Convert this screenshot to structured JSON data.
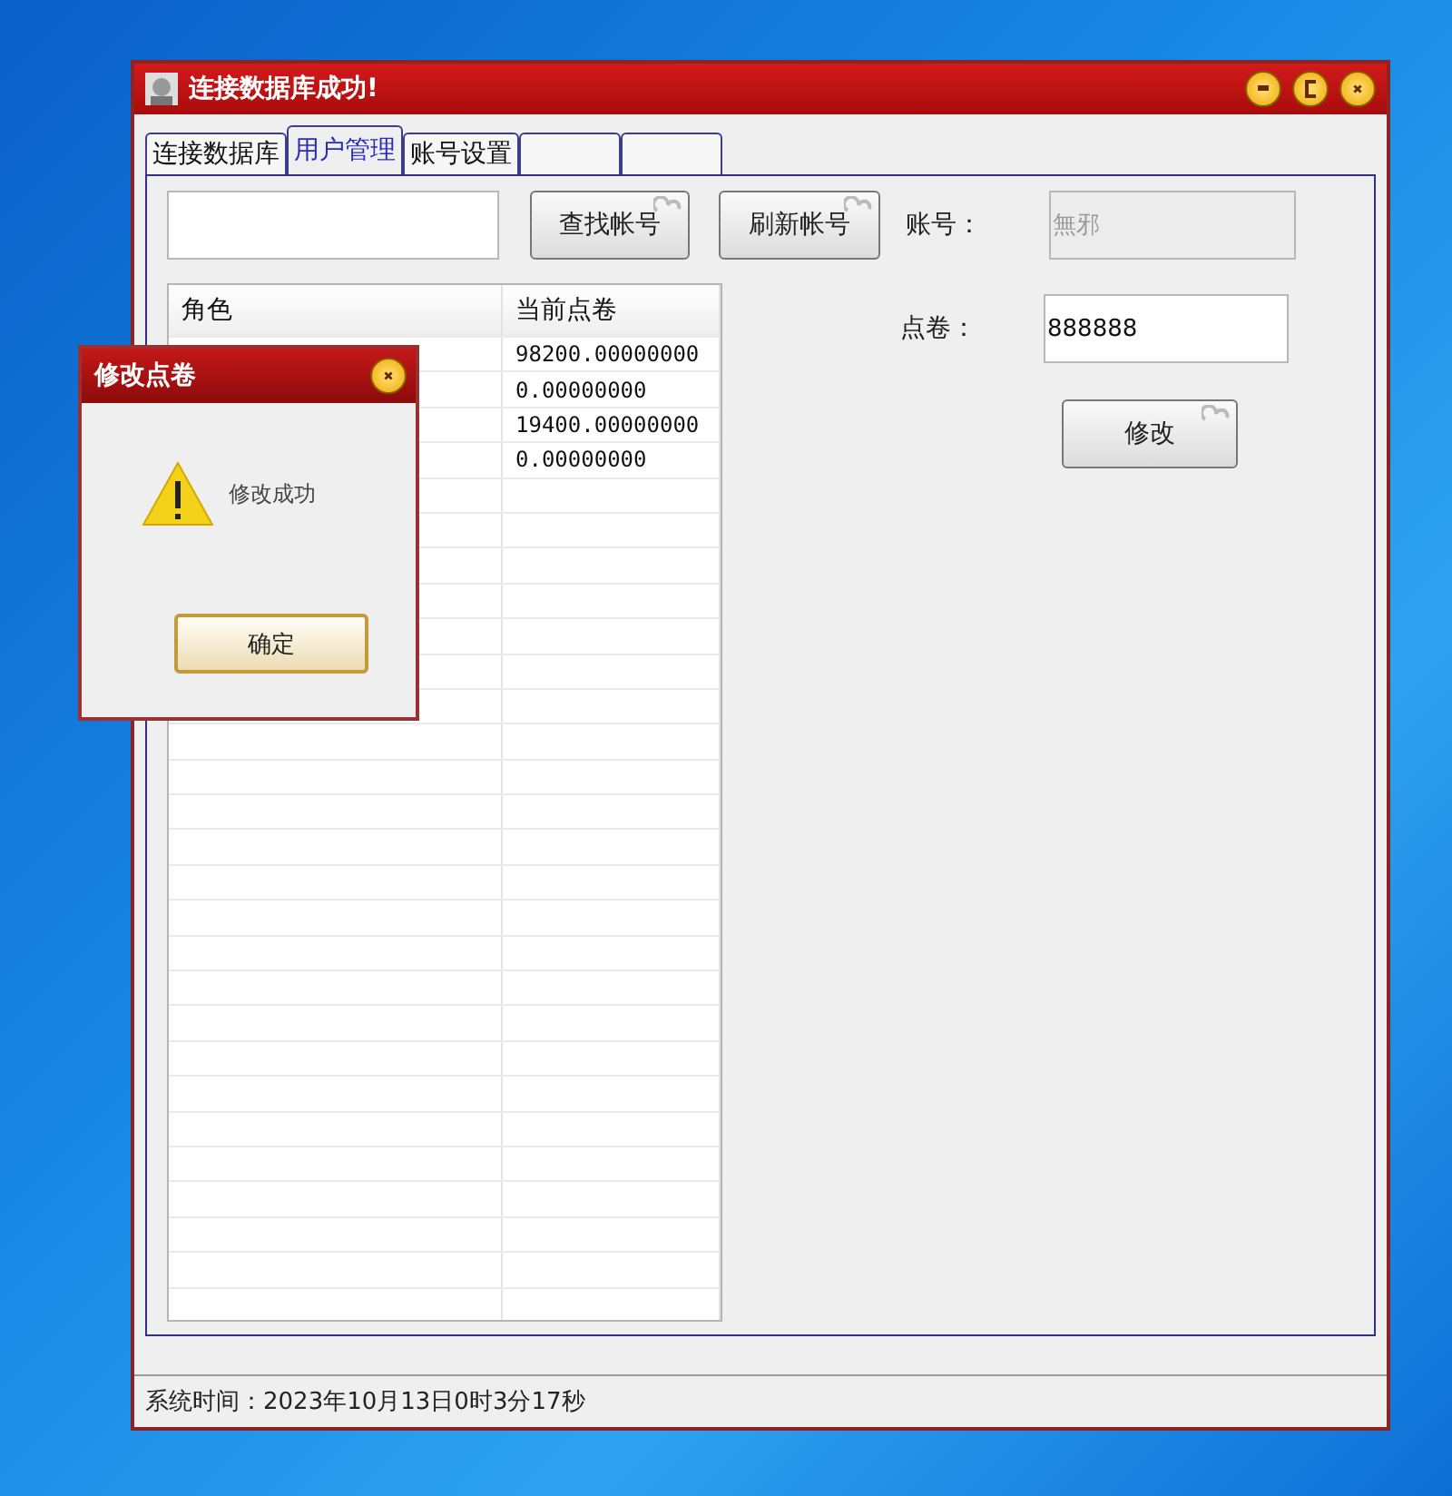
{
  "window": {
    "title": "连接数据库成功!"
  },
  "tabs": [
    {
      "label": "连接数据库",
      "selected": false
    },
    {
      "label": "用户管理",
      "selected": true
    },
    {
      "label": "账号设置",
      "selected": false
    },
    {
      "selected": false
    },
    {
      "selected": false
    }
  ],
  "toolbar": {
    "buttons": [
      "查找帐号",
      "刷新帐号"
    ]
  },
  "account": {
    "label": "账号：",
    "value": "無邪",
    "disabled": true
  },
  "points": {
    "label": "点卷：",
    "value": "888888",
    "disabled": false
  },
  "modify_button": "修改",
  "table": {
    "columns": [
      "角色",
      "当前点卷"
    ],
    "rows": [
      {
        "points": "98200.00000000"
      },
      {
        "points": "0.00000000"
      },
      {
        "points": "19400.00000000"
      },
      {
        "points": "0.00000000"
      }
    ]
  },
  "status_bar": "系统时间：2023年10月13日0时3分17秒",
  "dialog": {
    "title": "修改点卷",
    "message": "修改成功",
    "button": "确定"
  }
}
